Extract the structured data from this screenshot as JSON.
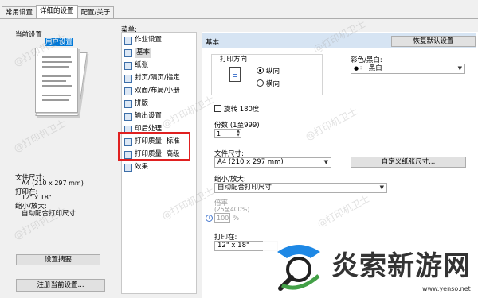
{
  "tabs": [
    {
      "label": "常用设置"
    },
    {
      "label": "详细的设置"
    },
    {
      "label": "配置/关于"
    }
  ],
  "left": {
    "current_settings_label": "当前设置",
    "preset_name": "用户设置",
    "paper_size_label": "文件尺寸:",
    "paper_size_value": "A4 (210 x 297 mm)",
    "print_on_label": "打印在:",
    "print_on_value": "12\" x 18\"",
    "scale_label": "缩小/放大:",
    "scale_value": "自动配合打印尺寸",
    "summary_button": "设置摘要",
    "register_button": "注册当前设置..."
  },
  "menu": {
    "label": "菜单:",
    "items": [
      {
        "label": "作业设置"
      },
      {
        "label": "基本"
      },
      {
        "label": "纸张"
      },
      {
        "label": "封页/隔页/指定"
      },
      {
        "label": "双面/布局/小册"
      },
      {
        "label": "拼版"
      },
      {
        "label": "输出设置"
      },
      {
        "label": "印后处理"
      },
      {
        "label": "打印质量: 标准"
      },
      {
        "label": "打印质量: 高级"
      },
      {
        "label": "效果"
      }
    ]
  },
  "panel": {
    "header": "基本",
    "restore_button": "恢复默认设置",
    "orientation_label": "打印方向",
    "portrait": "纵向",
    "landscape": "横向",
    "color_label": "彩色/黑白:",
    "color_value": "黑白",
    "rotate_label": "旋转 180度",
    "copies_label": "份数:(1至999)",
    "copies_value": "1",
    "paper_size_label": "文件尺寸:",
    "paper_size_value": "A4 (210 x 297 mm)",
    "custom_size_button": "自定义纸张尺寸...",
    "scale_label": "缩小/放大:",
    "scale_value": "自动配合打印尺寸",
    "ratio_label": "倍率:",
    "ratio_range": "(25至400%)",
    "ratio_value": "100",
    "print_on_label": "打印在:",
    "print_on_value": "12\" x 18\""
  },
  "watermark": {
    "text": "@打印机卫士",
    "site_logo": "炎索新游网",
    "site_url": "www.yenso.net"
  },
  "colors": {
    "accent": "#0078d7",
    "highlight_box": "#e02020",
    "panel_header": "#d6e4f3"
  }
}
